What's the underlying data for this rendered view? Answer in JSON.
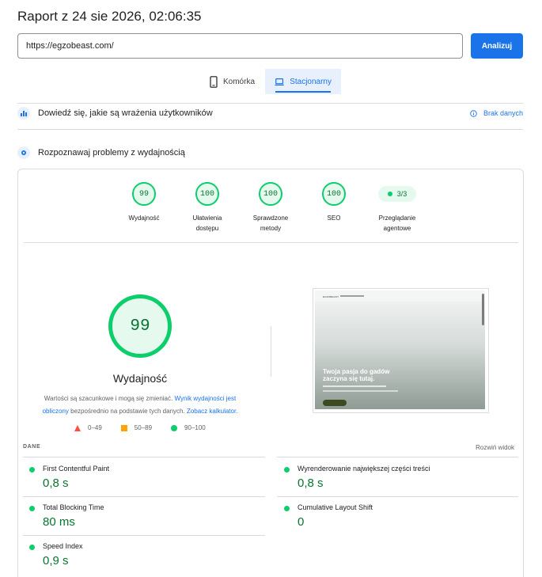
{
  "report": {
    "title": "Raport z 24 sie 2026, 02:06:35"
  },
  "form": {
    "url_value": "https://egzobeast.com/",
    "analyze_label": "Analizuj"
  },
  "tabs": {
    "mobile": "Komórka",
    "desktop": "Stacjonarny",
    "active": "desktop"
  },
  "field_data": {
    "title": "Dowiedź się, jakie są wrażenia użytkowników",
    "no_data": "Brak danych"
  },
  "lab": {
    "title": "Rozpoznawaj problemy z wydajnością"
  },
  "categories": [
    {
      "score": "99",
      "label": "Wydajność"
    },
    {
      "score": "100",
      "label": "Ułatwienia dostępu"
    },
    {
      "score": "100",
      "label": "Sprawdzone metody"
    },
    {
      "score": "100",
      "label": "SEO"
    },
    {
      "score": "3/3",
      "label": "Przeglądanie agentowe"
    }
  ],
  "performance": {
    "score": "99",
    "label": "Wydajność",
    "note_prefix": "Wartości są szacunkowe i mogą się zmieniać.",
    "note_link1": "Wynik wydajności jest obliczony",
    "note_mid": "bezpośrednio na podstawie tych danych.",
    "note_link2": "Zobacz kalkulator."
  },
  "legend": {
    "fail": "0–49",
    "average": "50–89",
    "pass": "90–100"
  },
  "screenshot": {
    "logo": "EGZOBEAST",
    "hero": "Twoja pasja do gadów zaczyna się tutaj."
  },
  "metrics_header": {
    "label": "DANE",
    "expand": "Rozwiń widok"
  },
  "metrics": [
    {
      "name": "First Contentful Paint",
      "value": "0,8 s"
    },
    {
      "name": "Wyrenderowanie największej części treści",
      "value": "0,8 s"
    },
    {
      "name": "Total Blocking Time",
      "value": "80 ms"
    },
    {
      "name": "Cumulative Layout Shift",
      "value": "0"
    },
    {
      "name": "Speed Index",
      "value": "0,9 s"
    }
  ],
  "colors": {
    "accent": "#1a73e8",
    "pass": "#0cce6b",
    "pass_text": "#08752f",
    "average": "#ffa400",
    "fail": "#ff4e42"
  }
}
